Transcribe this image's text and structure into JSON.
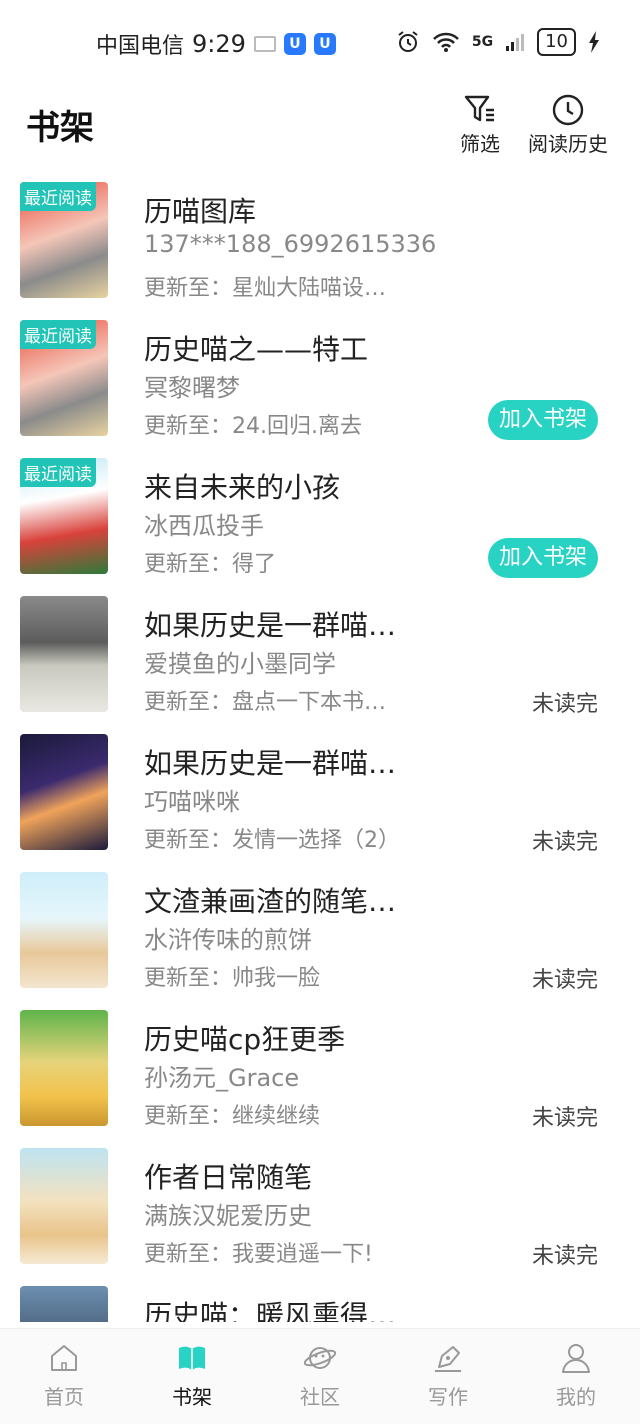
{
  "status_bar": {
    "carrier": "中国电信",
    "time": "9:29",
    "app_icon_1": "U",
    "app_icon_2": "U",
    "network": "5G",
    "battery": "10"
  },
  "header": {
    "title": "书架",
    "filter_label": "筛选",
    "history_label": "阅读历史"
  },
  "books": [
    {
      "title": "历喵图库",
      "author": "137***188_6992615336",
      "update": "更新至：星灿大陆喵设…",
      "badge": "最近阅读",
      "action": "",
      "status": ""
    },
    {
      "title": "历史喵之——特工",
      "author": "冥黎曙梦",
      "update": "更新至：24.回归.离去",
      "badge": "最近阅读",
      "action": "加入书架",
      "status": ""
    },
    {
      "title": "来自未来的小孩",
      "author": "冰西瓜投手",
      "update": "更新至：得了",
      "badge": "最近阅读",
      "action": "加入书架",
      "status": ""
    },
    {
      "title": "如果历史是一群喵…",
      "author": "爱摸鱼的小墨同学",
      "update": "更新至：盘点一下本书…",
      "badge": "",
      "action": "",
      "status": "未读完"
    },
    {
      "title": "如果历史是一群喵…",
      "author": "巧喵咪咪",
      "update": "更新至：发情一选择（2）",
      "badge": "",
      "action": "",
      "status": "未读完"
    },
    {
      "title": "文渣兼画渣的随笔…",
      "author": "水浒传味的煎饼",
      "update": "更新至：帅我一脸",
      "badge": "",
      "action": "",
      "status": "未读完"
    },
    {
      "title": "历史喵cp狂更季",
      "author": "孙汤元_Grace",
      "update": "更新至：继续继续",
      "badge": "",
      "action": "",
      "status": "未读完"
    },
    {
      "title": "作者日常随笔",
      "author": "满族汉妮爱历史",
      "update": "更新至：我要逍遥一下!",
      "badge": "",
      "action": "",
      "status": "未读完"
    },
    {
      "title": "历史喵：暖风熏得…",
      "author": "",
      "update": "",
      "badge": "",
      "action": "",
      "status": ""
    }
  ],
  "tabs": [
    {
      "label": "首页",
      "icon": "home-icon"
    },
    {
      "label": "书架",
      "icon": "book-icon"
    },
    {
      "label": "社区",
      "icon": "planet-icon"
    },
    {
      "label": "写作",
      "icon": "pen-icon"
    },
    {
      "label": "我的",
      "icon": "profile-icon"
    }
  ],
  "colors": {
    "accent": "#29d3c4",
    "badge": "#21c4b6",
    "text_secondary": "#888888"
  }
}
